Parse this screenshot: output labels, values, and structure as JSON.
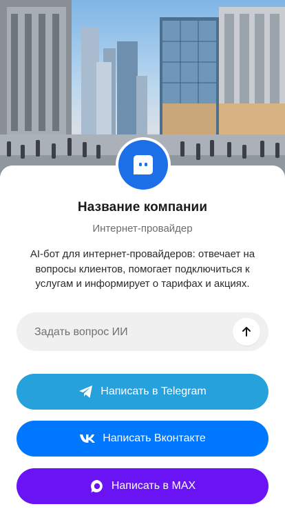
{
  "company": {
    "name": "Название компании",
    "type": "Интернет-провайдер",
    "description": "AI-бот для интернет-провайдеров: отвечает на вопросы клиентов, помогает подключиться к услугам и информирует о тарифах и акциях."
  },
  "ask": {
    "placeholder": "Задать вопрос ИИ",
    "send_icon": "arrow-up-icon"
  },
  "buttons": {
    "telegram": {
      "label": "Написать в Telegram",
      "icon": "telegram-icon",
      "color": "#27a1dc"
    },
    "vk": {
      "label": "Написать Вконтакте",
      "icon": "vk-icon",
      "color": "#0077ff"
    },
    "max": {
      "label": "Написать в MAX",
      "icon": "max-icon",
      "color": "#6a13f5"
    }
  },
  "colors": {
    "avatar": "#1d6fe8"
  }
}
